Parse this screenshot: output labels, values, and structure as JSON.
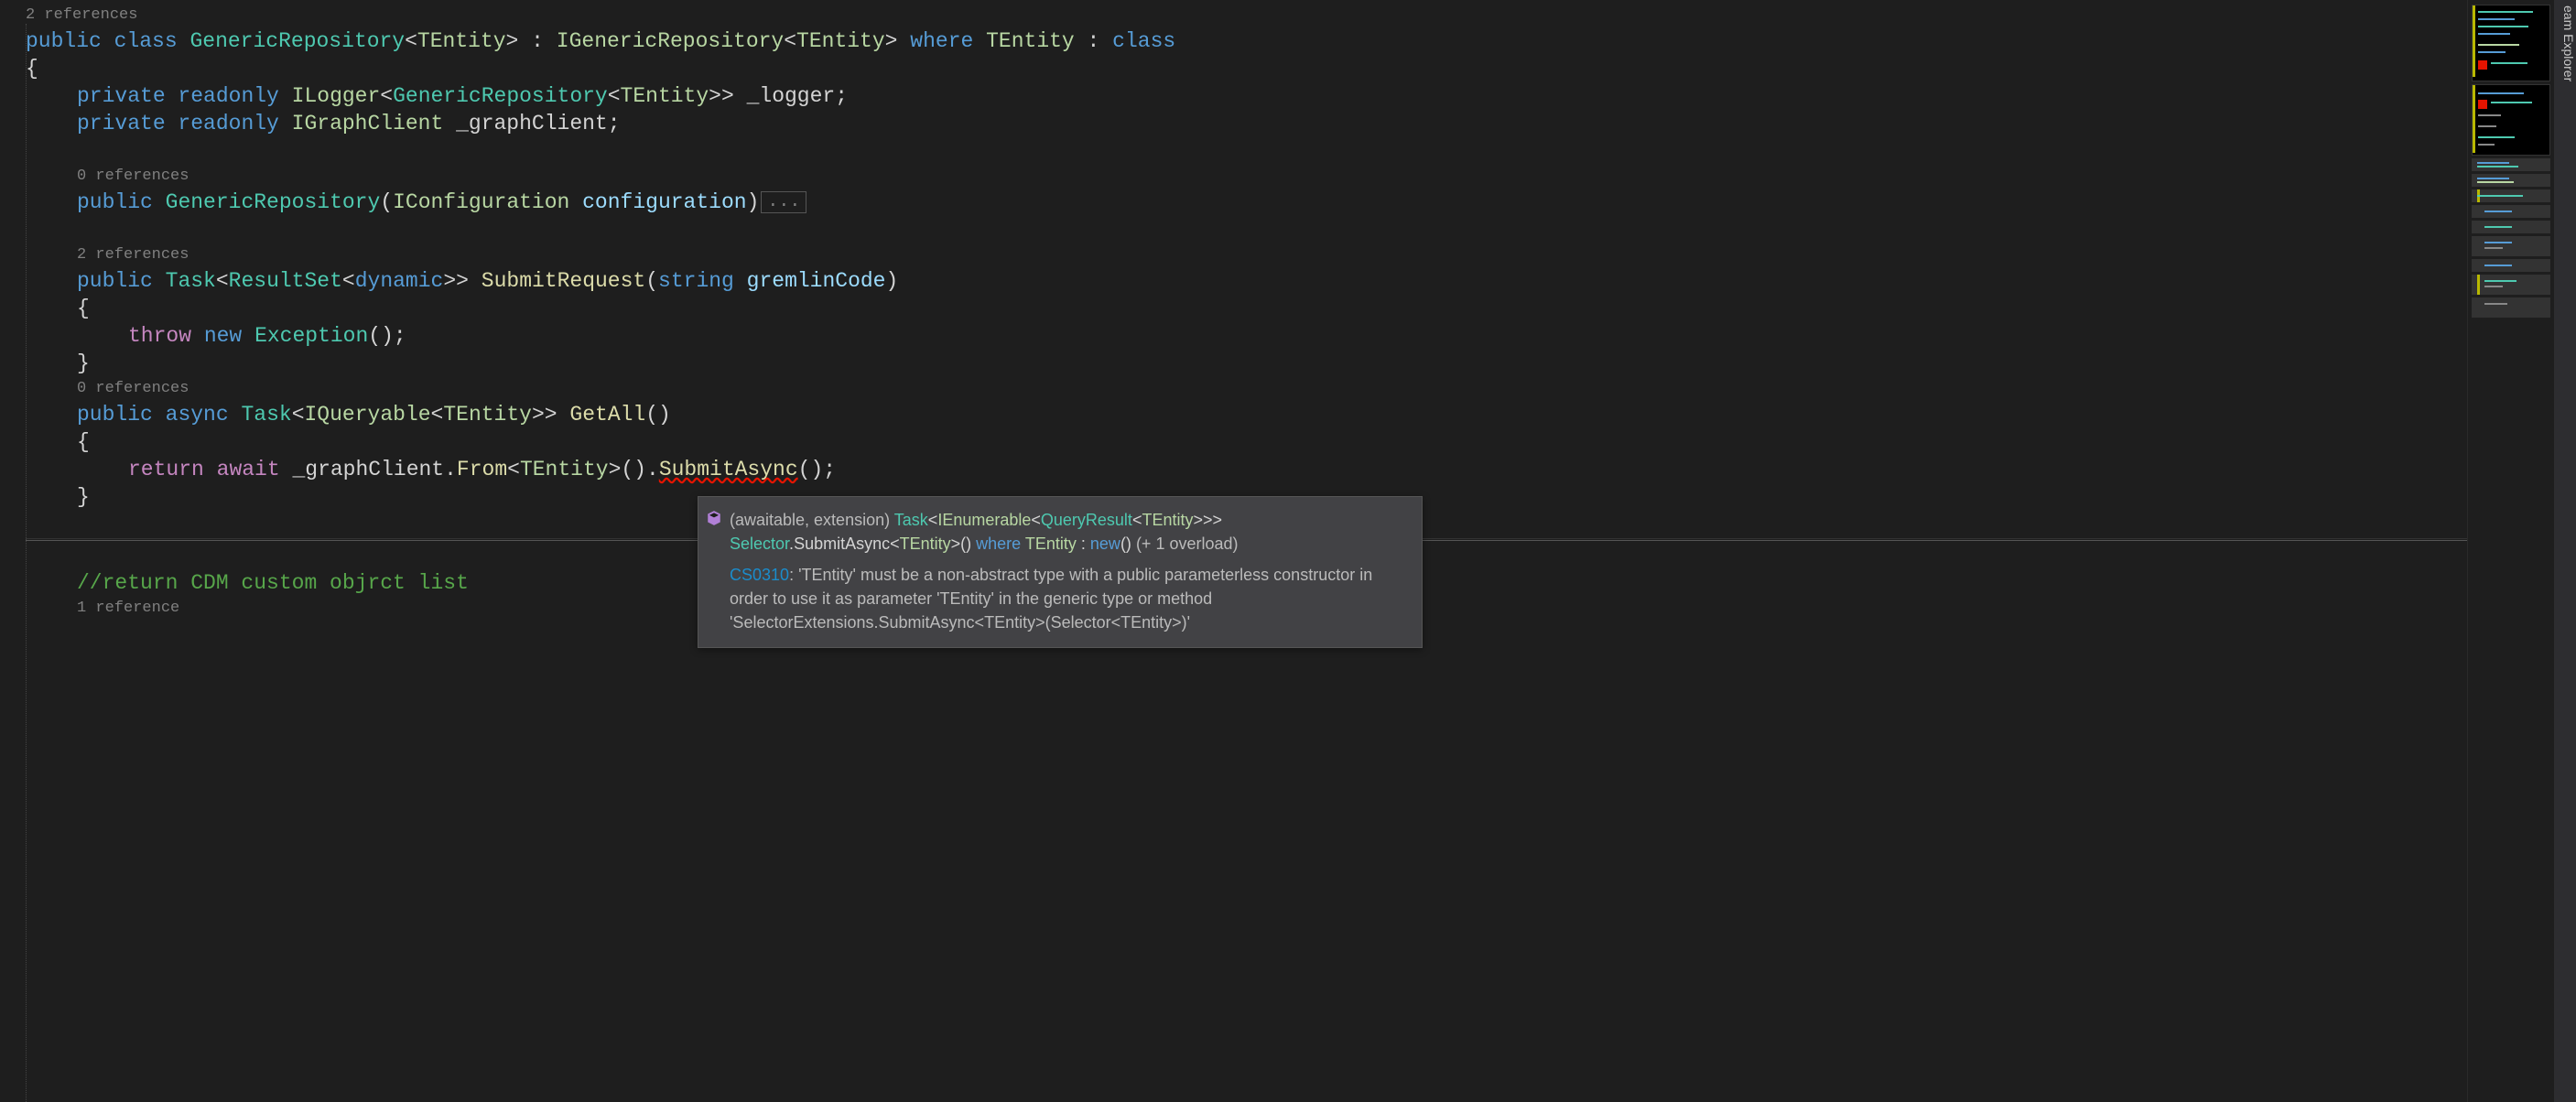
{
  "sideTab": "eam Explorer",
  "code": {
    "ref_2": "2 references",
    "ref_0a": "0 references",
    "ref_2b": "2 references",
    "ref_0b": "0 references",
    "ref_1": "1 reference",
    "collapsed": "...",
    "class_decl": {
      "public": "public",
      "class": "class",
      "name": "GenericRepository",
      "lt": "<",
      "tparam": "TEntity",
      "gt": ">",
      "colon": " : ",
      "iface": "IGenericRepository",
      "lt2": "<",
      "tparam2": "TEntity",
      "gt2": ">",
      "where": " where ",
      "tparam3": "TEntity",
      "colon2": " : ",
      "classkw": "class"
    },
    "brace_open": "{",
    "brace_close": "}",
    "field1": {
      "private": "private",
      "readonly": " readonly ",
      "itype": "ILogger",
      "lt": "<",
      "gtype": "GenericRepository",
      "lt2": "<",
      "tparam": "TEntity",
      "gt2": ">",
      "gt": ">",
      "name": " _logger",
      "semi": ";"
    },
    "field2": {
      "private": "private",
      "readonly": " readonly ",
      "itype": "IGraphClient",
      "name": " _graphClient",
      "semi": ";"
    },
    "ctor": {
      "public": "public",
      "sp": " ",
      "name": "GenericRepository",
      "open": "(",
      "ptype": "IConfiguration",
      "pname": " configuration",
      "close": ")"
    },
    "submit": {
      "public": "public",
      "sp": " ",
      "task": "Task",
      "lt": "<",
      "rset": "ResultSet",
      "lt2": "<",
      "dyn": "dynamic",
      "gt2": ">",
      "gt": ">",
      "sp2": " ",
      "name": "SubmitRequest",
      "open": "(",
      "str": "string",
      "pname": " gremlinCode",
      "close": ")"
    },
    "throw": {
      "throw": "throw",
      "sp": " ",
      "new": "new",
      "sp2": " ",
      "exc": "Exception",
      "parens": "()",
      "semi": ";"
    },
    "getall": {
      "public": "public",
      "sp": " ",
      "async": "async",
      "sp2": " ",
      "task": "Task",
      "lt": "<",
      "iq": "IQueryable",
      "lt2": "<",
      "tparam": "TEntity",
      "gt2": ">",
      "gt": ">",
      "sp3": " ",
      "name": "GetAll",
      "parens": "()"
    },
    "return": {
      "return": "return",
      "sp": " ",
      "await": "await",
      "sp2": " ",
      "field": "_graphClient",
      "dot": ".",
      "from": "From",
      "lt": "<",
      "tparam": "TEntity",
      "gt": ">",
      "parens": "()",
      "dot2": ".",
      "submit": "SubmitAsync",
      "parens2": "()",
      "semi": ";"
    },
    "comment": "//return CDM custom objrct list"
  },
  "tooltip": {
    "prefix": "(awaitable, extension) ",
    "task": "Task",
    "lt": "<",
    "ienum": "IEnumerable",
    "lt2": "<",
    "qr": "QueryResult",
    "lt3": "<",
    "tparam": "TEntity",
    "gt3": ">",
    "gt2": ">",
    "gt": "> ",
    "selector": "Selector",
    "dot": ".",
    "method": "SubmitAsync",
    "lt4": "<",
    "tparam2": "TEntity",
    "gt4": ">",
    "parens": "() ",
    "where": "where",
    "sp": " ",
    "tparam3": "TEntity",
    "colon": " : ",
    "new": "new",
    "parens2": "()",
    "overload": " (+ 1 overload)",
    "err_code": "CS0310",
    "err_msg": ": 'TEntity' must be a non-abstract type with a public parameterless constructor in order to use it as parameter 'TEntity' in the generic type or method 'SelectorExtensions.SubmitAsync<TEntity>(Selector<TEntity>)'"
  }
}
